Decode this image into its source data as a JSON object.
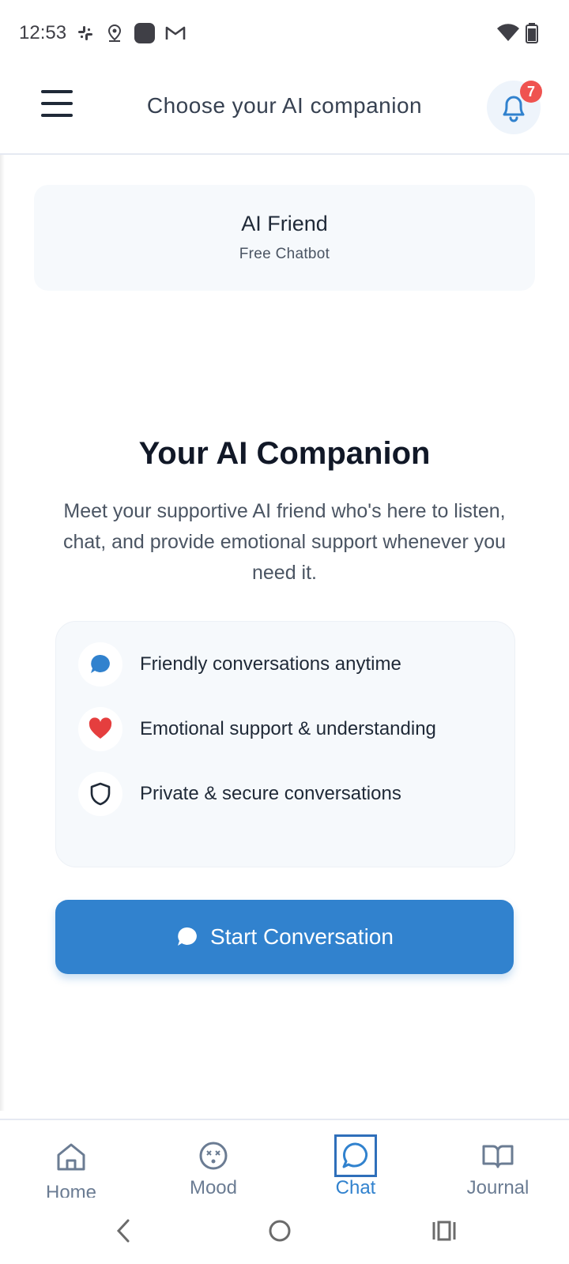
{
  "status_bar": {
    "time": "12:53"
  },
  "header": {
    "title": "Choose your AI companion",
    "notification_count": "7"
  },
  "companion": {
    "name": "AI Friend",
    "subtitle": "Free Chatbot"
  },
  "hero": {
    "title": "Your AI Companion",
    "description": "Meet your supportive AI friend who's here to listen, chat, and provide emotional support whenever you need it."
  },
  "features": [
    {
      "label": "Friendly conversations anytime",
      "icon": "chat-bubble-icon",
      "color": "#3182ce"
    },
    {
      "label": "Emotional support & understanding",
      "icon": "heart-icon",
      "color": "#e53e3e"
    },
    {
      "label": "Private & secure conversations",
      "icon": "shield-icon",
      "color": "#1f2937"
    }
  ],
  "start_button": {
    "label": "Start Conversation"
  },
  "bottom_nav": {
    "items": [
      {
        "label": "Home",
        "icon": "home-icon"
      },
      {
        "label": "Mood",
        "icon": "mood-face-icon"
      },
      {
        "label": "Chat",
        "icon": "chat-icon",
        "active": true
      },
      {
        "label": "Journal",
        "icon": "book-icon"
      }
    ]
  },
  "colors": {
    "accent": "#3182ce",
    "badge": "#ef5350",
    "card_bg": "#f6f9fc"
  }
}
